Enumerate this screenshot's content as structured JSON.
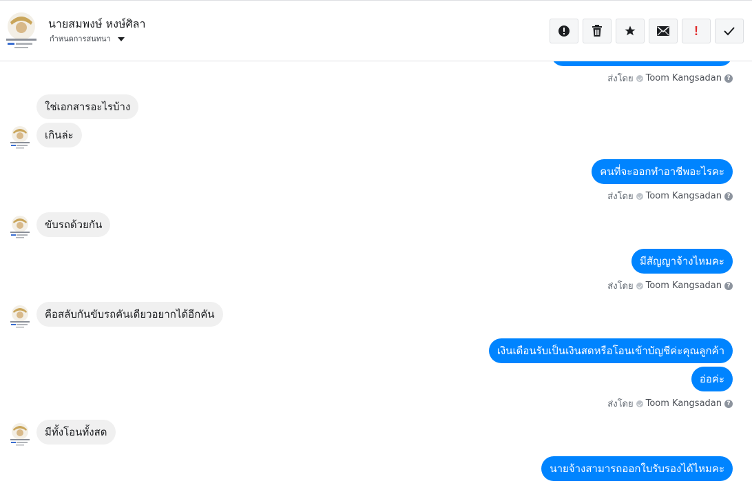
{
  "header": {
    "name": "นายสมพงษ์ หงษ์ศิลา",
    "assign_label": "กำหนดการสนทนา",
    "toolbar_icons": [
      "alert-circle-icon",
      "trash-icon",
      "star-icon",
      "mail-icon",
      "exclamation-icon",
      "check-icon"
    ]
  },
  "sent_by": {
    "prefix": "ส่งโดย",
    "agent": "Toom Kangsadan",
    "help": "?"
  },
  "messages": {
    "m1": "ใช่เอกสารอะไรบ้าง",
    "m2": "เกินล่ะ",
    "m3": "คนที่จะออกทำอาชีพอะไรคะ",
    "m4": "ขับรถด้วยกัน",
    "m5": "มีสัญญาจ้างไหมคะ",
    "m6": "คือสลับกันขับรถคันเดียวอยากได้อีกคัน",
    "m7": "เงินเดือนรับเป็นเงินสดหรือโอนเข้าบัญชีค่ะคุณลูกค้า",
    "m8": "อ่อค่ะ",
    "m9": "มีทั้งโอนทั้งสด",
    "m10": "นายจ้างสามารถออกใบรับรองได้ไหมคะ"
  },
  "colors": {
    "outgoing": "#0084ff",
    "incoming": "#f0f0f0",
    "danger": "#e02c2c"
  }
}
